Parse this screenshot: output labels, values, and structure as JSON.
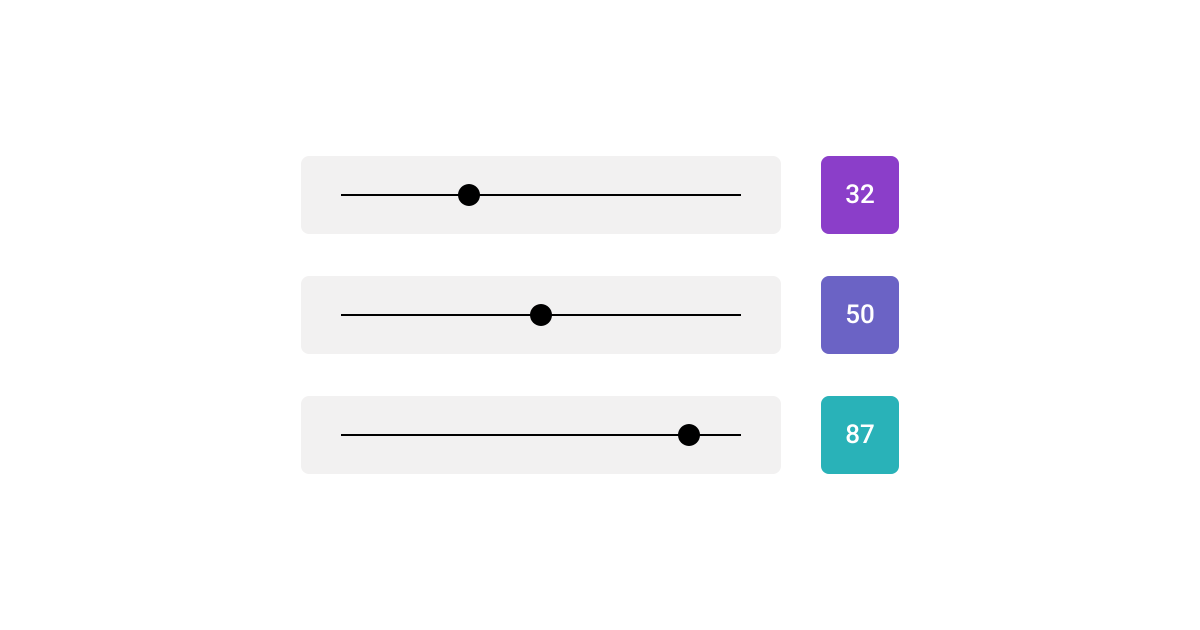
{
  "sliders": [
    {
      "value": 32,
      "position": 32,
      "color": "#8b3ec9"
    },
    {
      "value": 50,
      "position": 50,
      "color": "#6b63c5"
    },
    {
      "value": 87,
      "position": 87,
      "color": "#29b2b8"
    }
  ]
}
